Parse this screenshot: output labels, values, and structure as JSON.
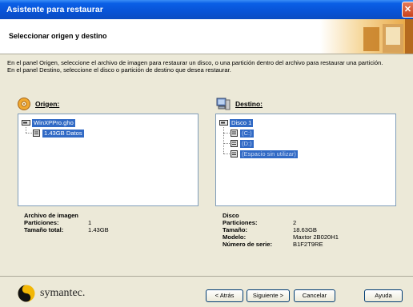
{
  "window": {
    "title": "Asistente para restaurar",
    "close_glyph": "✕"
  },
  "header": {
    "title": "Seleccionar origen y destino"
  },
  "intro": {
    "line1": "En el panel Origen, seleccione el archivo de imagen para restaurar un disco, o una partición dentro del archivo para restaurar una partición.",
    "line2": "En el panel Destino, seleccione el disco o partición de destino que desea restaurar."
  },
  "origin": {
    "label": "Origen:",
    "icon": "disk-image-icon",
    "tree": {
      "root": "WinXPPro.gho",
      "child": "1.43GB Datos"
    },
    "info": {
      "title": "Archivo de imagen",
      "partitions_label": "Particiones:",
      "partitions_value": "1",
      "size_label": "Tamaño total:",
      "size_value": "1.43GB"
    }
  },
  "destination": {
    "label": "Destino:",
    "icon": "computer-icon",
    "tree": {
      "root": "Disco 1",
      "items": [
        "(C:)",
        "(D:)",
        "(Espacio sin utilizar)"
      ]
    },
    "info": {
      "title": "Disco",
      "partitions_label": "Particiones:",
      "partitions_value": "2",
      "size_label": "Tamaño:",
      "size_value": "18.63GB",
      "model_label": "Modelo:",
      "model_value": "Maxtor 2B020H1",
      "serial_label": "Número de serie:",
      "serial_value": "B1F2T9RE"
    }
  },
  "footer": {
    "logo": "symantec.",
    "back": "< Atrás",
    "next": "Siguiente >",
    "cancel": "Cancelar",
    "help": "Ayuda"
  },
  "colors": {
    "titlebar": "#0853d6",
    "selection": "#316ac5",
    "face": "#ece9d8",
    "logo_yellow": "#f2b705"
  }
}
